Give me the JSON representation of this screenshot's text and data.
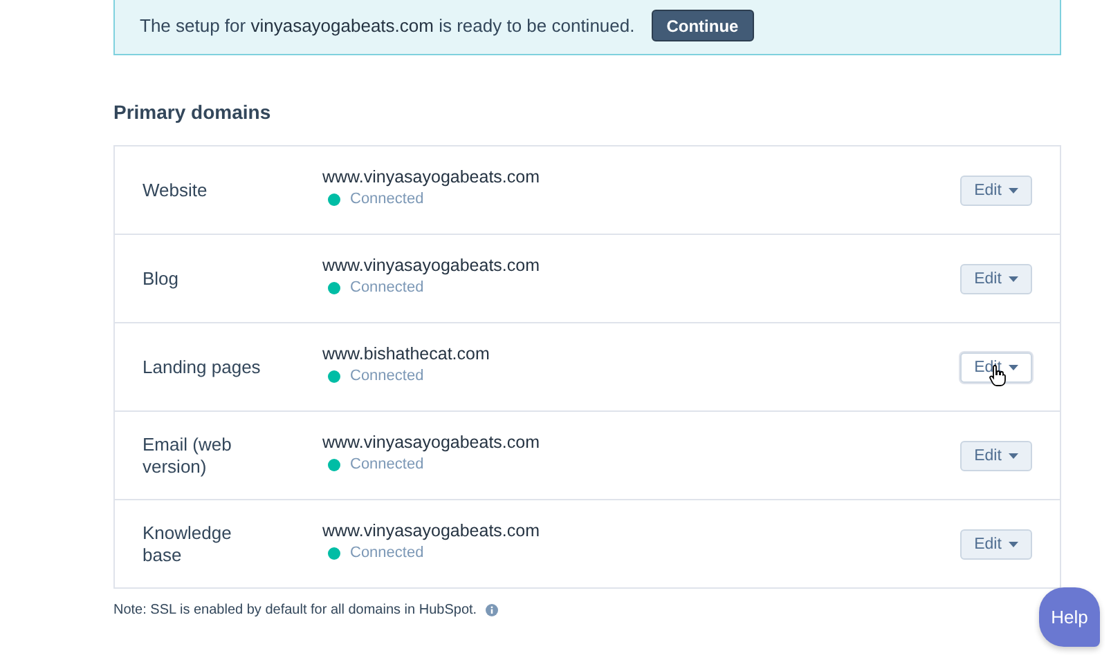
{
  "banner": {
    "message": "The setup for **vinyasayogabeats.com** is ready to be continued.",
    "button": "Continue"
  },
  "section_title": "Primary domains",
  "domains": [
    {
      "label": "Website",
      "domain": "www.vinyasayogabeats.com",
      "status": "Connected",
      "color": "#00bda5",
      "button": "Edit",
      "hovered": false
    },
    {
      "label": "Blog",
      "domain": "www.vinyasayogabeats.com",
      "status": "Connected",
      "color": "#00bda5",
      "button": "Edit",
      "hovered": false
    },
    {
      "label": "Landing pages",
      "domain": "www.bishathecat.com",
      "status": "Connected",
      "color": "#00bda5",
      "button": "Edit",
      "hovered": true
    },
    {
      "label": "Email (web version)",
      "domain": "www.vinyasayogabeats.com",
      "status": "Connected",
      "color": "#00bda5",
      "button": "Edit",
      "hovered": false
    },
    {
      "label": "Knowledge base",
      "domain": "www.vinyasayogabeats.com",
      "status": "Connected",
      "color": "#00bda5",
      "button": "Edit",
      "hovered": false
    }
  ],
  "note": "Note: SSL is enabled by default for all domains in HubSpot.",
  "help_button": "Help"
}
